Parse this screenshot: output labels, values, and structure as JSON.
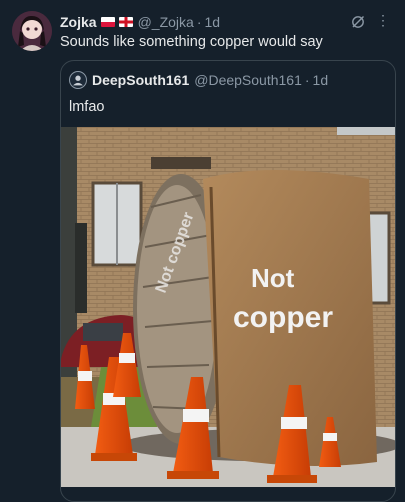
{
  "tweet": {
    "display_name": "Zojka",
    "handle": "@_Zojka",
    "separator": "·",
    "time": "1d",
    "text": "Sounds like something copper would say",
    "icons": [
      "poland-flag-icon",
      "england-flag-icon",
      "grok-icon",
      "more-icon"
    ]
  },
  "quoted_tweet": {
    "display_name": "DeepSouth161",
    "handle": "@DeepSouth161",
    "separator": "·",
    "time": "1d",
    "text": "lmfao",
    "image_text": [
      "Not copper",
      "Not copper"
    ]
  },
  "colors": {
    "background": "#15202b",
    "text_primary": "#e7e9ea",
    "text_secondary": "#8b98a5",
    "border": "#38444d"
  }
}
